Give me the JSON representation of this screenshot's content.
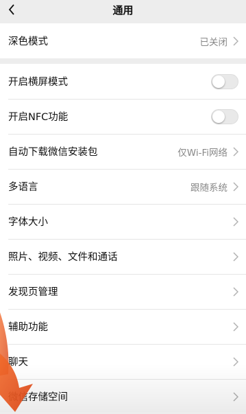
{
  "header": {
    "title": "通用",
    "back_icon": "chevron-left-icon"
  },
  "group1": {
    "dark_mode": {
      "label": "深色模式",
      "value": "已关闭"
    }
  },
  "group2": {
    "landscape": {
      "label": "开启横屏模式",
      "on": false
    },
    "nfc": {
      "label": "开启NFC功能",
      "on": false
    },
    "auto_download": {
      "label": "自动下载微信安装包",
      "value": "仅Wi-Fi网络"
    },
    "language": {
      "label": "多语言",
      "value": "跟随系统"
    },
    "font_size": {
      "label": "字体大小"
    },
    "media": {
      "label": "照片、视频、文件和通话"
    },
    "discover": {
      "label": "发现页管理"
    },
    "accessibility": {
      "label": "辅助功能"
    },
    "chat_tools": {
      "label": "聊天"
    },
    "storage": {
      "label": "微信存储空间"
    }
  },
  "colors": {
    "arrow": "#e8541e",
    "background": "#ededed",
    "secondary_text": "#888888"
  }
}
